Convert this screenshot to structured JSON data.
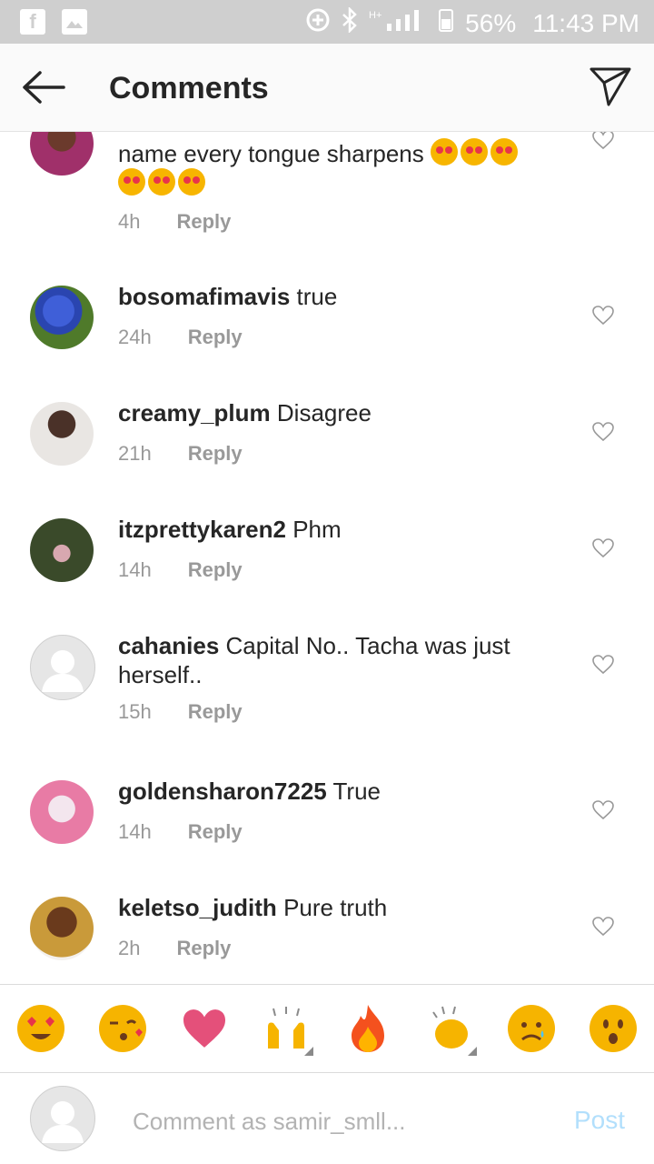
{
  "status_bar": {
    "battery": "56%",
    "time": "11:43 PM",
    "network": "H+"
  },
  "header": {
    "title": "Comments"
  },
  "comments": [
    {
      "username": "",
      "text": "name every tongue sharpens",
      "time": "4h",
      "reply": "Reply"
    },
    {
      "username": "bosomafimavis",
      "text": "true",
      "time": "24h",
      "reply": "Reply"
    },
    {
      "username": "creamy_plum",
      "text": "Disagree",
      "time": "21h",
      "reply": "Reply"
    },
    {
      "username": "itzprettykaren2",
      "text": "Phm",
      "time": "14h",
      "reply": "Reply"
    },
    {
      "username": "cahanies",
      "text": "Capital No.. Tacha was just herself..",
      "time": "15h",
      "reply": "Reply"
    },
    {
      "username": "goldensharon7225",
      "text": "True",
      "time": "14h",
      "reply": "Reply"
    },
    {
      "username": "keletso_judith",
      "text": "Pure truth",
      "time": "2h",
      "reply": "Reply"
    }
  ],
  "emoji_bar": [
    "heart-eyes",
    "kissing-heart",
    "red-heart",
    "raised-hands",
    "fire",
    "clapping-hands",
    "sad-face",
    "surprised-face"
  ],
  "composer": {
    "placeholder": "Comment as samir_smll...",
    "post_label": "Post"
  },
  "colors": {
    "accent_disabled": "#b2dffc",
    "meta_gray": "#999999",
    "text": "#262626"
  }
}
